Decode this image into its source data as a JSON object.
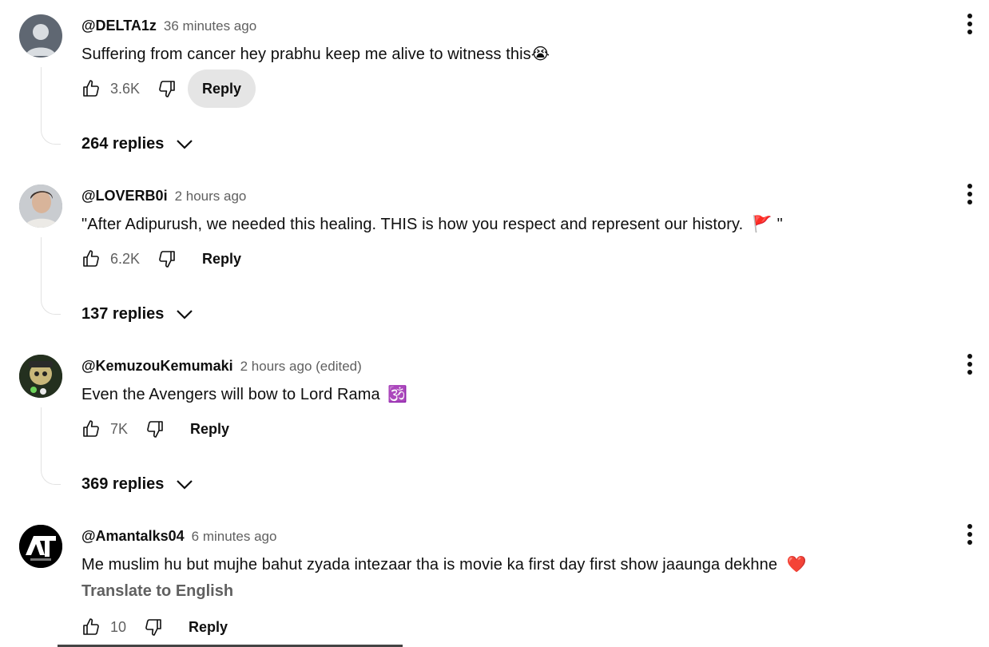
{
  "comments": [
    {
      "author": "@DELTA1z",
      "time": "36 minutes ago",
      "text": "Suffering from cancer hey prabhu keep me alive to witness this",
      "emoji": "😭",
      "likes": "3.6K",
      "reply_label": "Reply",
      "replies_label": "264 replies"
    },
    {
      "author": "@LOVERB0i",
      "time": "2 hours ago",
      "text": "\"After Adipurush, we needed this healing. THIS is how you respect and represent our history.",
      "emoji": "🚩",
      "text_end": "\"",
      "likes": "6.2K",
      "reply_label": "Reply",
      "replies_label": "137 replies"
    },
    {
      "author": "@KemuzouKemumaki",
      "time": "2 hours ago (edited)",
      "text": "Even the Avengers will bow to Lord Rama",
      "emoji": "🕉️",
      "likes": "7K",
      "reply_label": "Reply",
      "replies_label": "369 replies"
    },
    {
      "author": "@Amantalks04",
      "time": "6 minutes ago",
      "text": "Me muslim hu but mujhe bahut zyada intezaar tha is movie ka first day first show jaaunga dekhne",
      "emoji": "❤️",
      "translate_label": "Translate to English",
      "likes": "10",
      "reply_label": "Reply"
    }
  ],
  "icons": {
    "like": "thumbs-up-icon",
    "dislike": "thumbs-down-icon",
    "expand": "chevron-down-icon",
    "menu": "more-vert-icon"
  },
  "colors": {
    "secondary_text": "#606060",
    "reply_hover_bg": "#e5e5e5",
    "thread_line": "#e2e2e2"
  }
}
